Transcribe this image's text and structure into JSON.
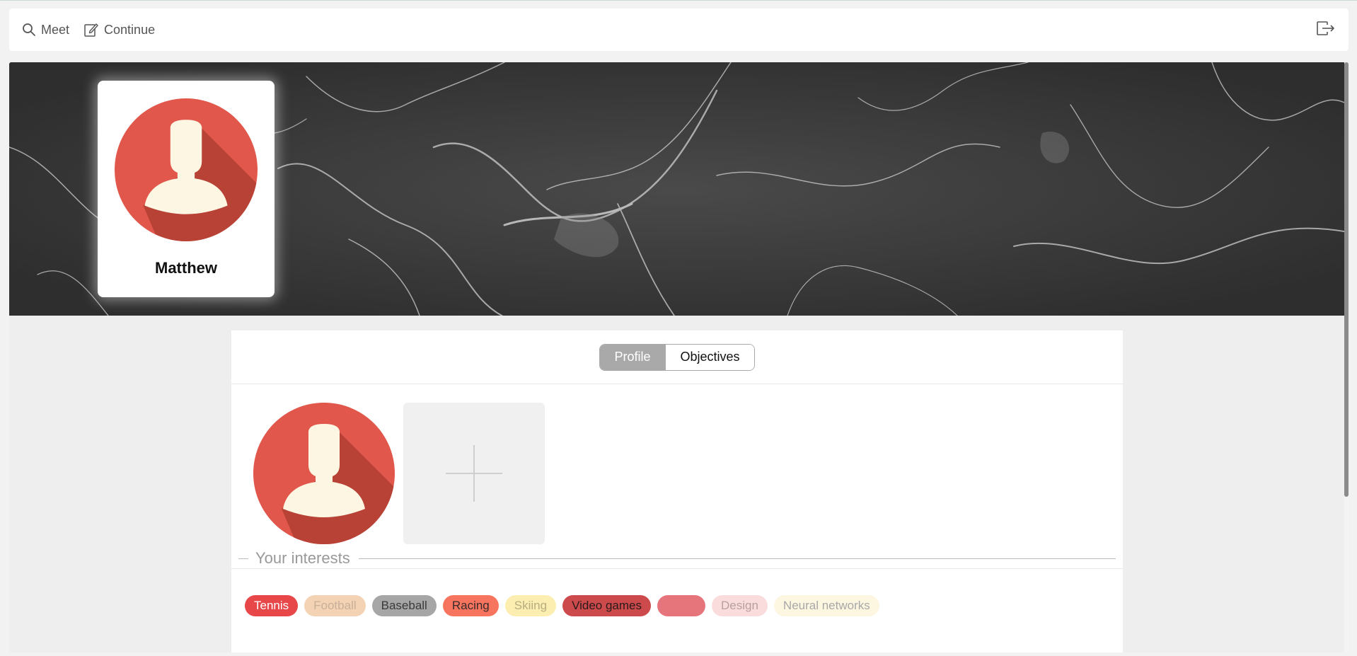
{
  "nav": {
    "meet_label": "Meet",
    "continue_label": "Continue",
    "icons": {
      "meet": "search-icon",
      "continue": "edit-icon",
      "logout": "logout-icon"
    }
  },
  "profile": {
    "name": "Matthew",
    "avatar": "user-avatar-icon",
    "add_photo_icon": "plus-icon"
  },
  "tabs": [
    {
      "label": "Profile",
      "active": true
    },
    {
      "label": "Objectives",
      "active": false
    }
  ],
  "interests": {
    "title": "Your interests",
    "tags": [
      {
        "label": "Tennis",
        "bg": "#e8474a",
        "fg": "#ffffff"
      },
      {
        "label": "Football",
        "bg": "#f3d3b3",
        "fg": "#c8b09a"
      },
      {
        "label": "Baseball",
        "bg": "#a6a6a6",
        "fg": "#3a3a3a"
      },
      {
        "label": "Racing",
        "bg": "#f7755e",
        "fg": "#3a2a2a"
      },
      {
        "label": "Skiing",
        "bg": "#fbeeb0",
        "fg": "#b9ad80"
      },
      {
        "label": "Video games",
        "bg": "#cc4a4c",
        "fg": "#2a1a1a"
      },
      {
        "label": "",
        "bg": "#e6757b",
        "fg": "#e6757b"
      },
      {
        "label": "Design",
        "bg": "#fbdcdc",
        "fg": "#b8a0a0"
      },
      {
        "label": "Neural networks",
        "bg": "#fdf6e0",
        "fg": "#a8a8a8"
      }
    ]
  },
  "colors": {
    "avatar_circle": "#e1574b",
    "avatar_shadow": "#b84236",
    "avatar_figure": "#fdf6e3",
    "tab_active": "#a9a9a9",
    "banner": "#3b3b3b"
  }
}
